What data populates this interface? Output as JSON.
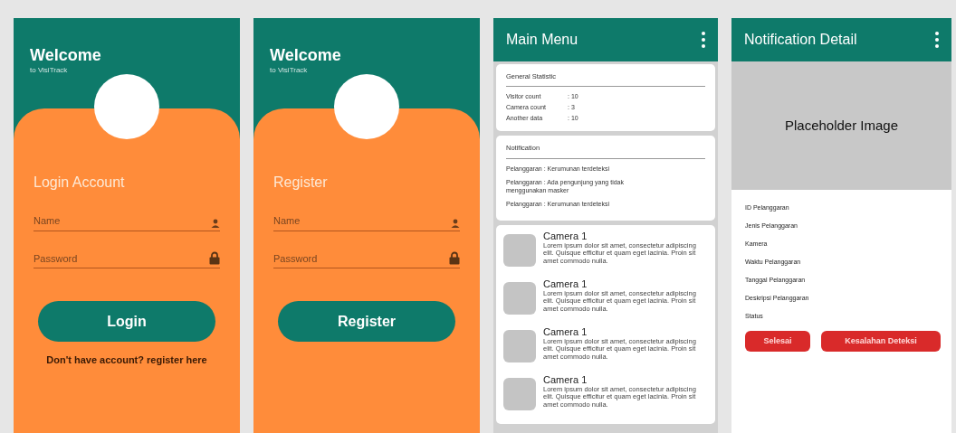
{
  "login_screen": {
    "welcome": "Welcome",
    "subtitle": "to VisiTrack",
    "heading": "Login Account",
    "fields": [
      {
        "placeholder": "Name",
        "kind": "user"
      },
      {
        "placeholder": "Password",
        "kind": "lock"
      }
    ],
    "button": "Login",
    "link": "Don't have account? register here"
  },
  "register_screen": {
    "welcome": "Welcome",
    "subtitle": "to VisiTrack",
    "heading": "Register",
    "fields": [
      {
        "placeholder": "Name",
        "kind": "user"
      },
      {
        "placeholder": "Password",
        "kind": "lock"
      }
    ],
    "button": "Register"
  },
  "main_menu": {
    "title": "Main Menu",
    "statistics": {
      "title": "General Statistic",
      "rows": [
        {
          "label": "Visitor count",
          "value": ": 10"
        },
        {
          "label": "Camera count",
          "value": ": 3"
        },
        {
          "label": "Another data",
          "value": ": 10"
        }
      ]
    },
    "notifications": {
      "title": "Notification",
      "items": [
        "Pelanggaran : Kerumunan terdeteksi",
        "Pelanggaran : Ada pengunjung yang tidak menggunakan masker",
        "Pelanggaran : Kerumunan terdeteksi"
      ]
    },
    "cameras": [
      {
        "name": "Camera 1",
        "description": "Lorem ipsum dolor sit amet, consectetur adipiscing elit. Quisque efficitur et quam eget lacinia. Proin sit amet commodo nulla."
      },
      {
        "name": "Camera 1",
        "description": "Lorem ipsum dolor sit amet, consectetur adipiscing elit. Quisque efficitur et quam eget lacinia. Proin sit amet commodo nulla."
      },
      {
        "name": "Camera 1",
        "description": "Lorem ipsum dolor sit amet, consectetur adipiscing elit. Quisque efficitur et quam eget lacinia. Proin sit amet commodo nulla."
      },
      {
        "name": "Camera 1",
        "description": "Lorem ipsum dolor sit amet, consectetur adipiscing elit. Quisque efficitur et quam eget lacinia. Proin sit amet commodo nulla."
      }
    ]
  },
  "notification_detail": {
    "title": "Notification Detail",
    "image_label": "Placeholder Image",
    "fields": [
      "ID Pelanggaran",
      "Jenis Pelanggaran",
      "Kamera",
      "Waktu Pelanggaran",
      "Tanggal Pelanggaran",
      "Deskripsi Pelanggaran",
      "Status"
    ],
    "buttons": [
      "Selesai",
      "Kesalahan Deteksi"
    ]
  }
}
